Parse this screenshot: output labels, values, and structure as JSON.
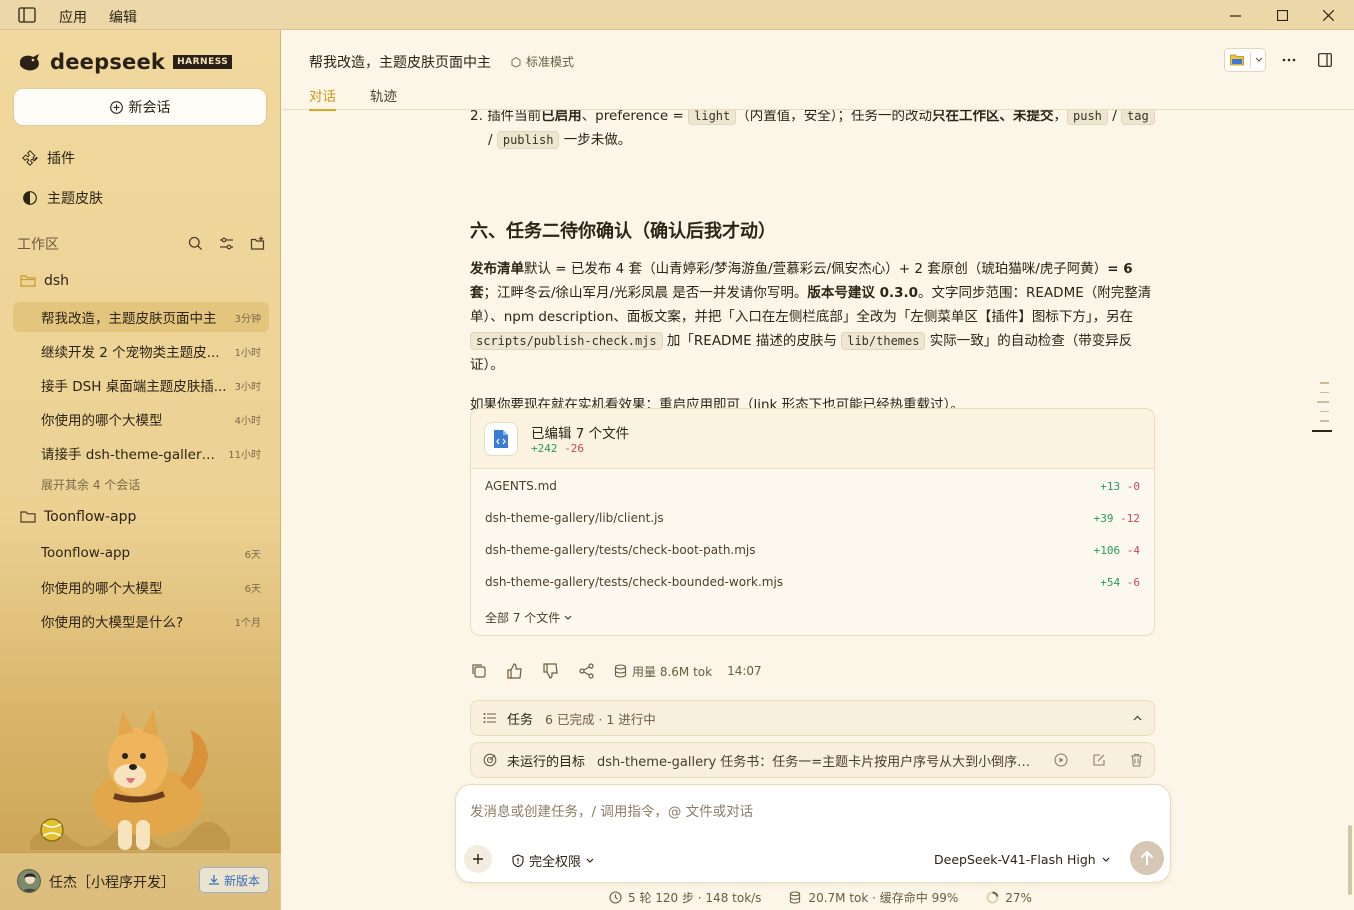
{
  "titlebar": {
    "menu": [
      "应用",
      "编辑"
    ]
  },
  "sidebar": {
    "brand": "deepseek",
    "brand_badge": "HARNESS",
    "new_chat": "新会话",
    "nav": [
      {
        "label": "插件",
        "icon": "puzzle-icon"
      },
      {
        "label": "主题皮肤",
        "icon": "theme-icon"
      }
    ],
    "workspace_label": "工作区",
    "folders": [
      {
        "name": "dsh",
        "sessions": [
          {
            "title": "帮我改造，主题皮肤页面中主",
            "time": "3分钟",
            "active": true
          },
          {
            "title": "继续开发 2 个宠物类主题皮...",
            "time": "1小时"
          },
          {
            "title": "接手 DSH 桌面端主题皮肤插...",
            "time": "3小时"
          },
          {
            "title": "你使用的哪个大模型",
            "time": "4小时"
          },
          {
            "title": "请接手 dsh-theme-gallery ...",
            "time": "11小时"
          }
        ],
        "more": "展开其余 4 个会话"
      },
      {
        "name": "Toonflow-app",
        "sessions": [
          {
            "title": "Toonflow-app",
            "time": "6天"
          },
          {
            "title": "你使用的哪个大模型",
            "time": "6天"
          },
          {
            "title": "你使用的大模型是什么?",
            "time": "1个月"
          }
        ]
      }
    ],
    "user": {
      "name": "任杰［小程序开发］",
      "new_version": "新版本"
    }
  },
  "header": {
    "title": "帮我改造，主题皮肤页面中主",
    "mode": "标准模式",
    "tabs": [
      {
        "label": "对话",
        "active": true
      },
      {
        "label": "轨迹",
        "active": false
      }
    ]
  },
  "message": {
    "list_item": {
      "num": "2.",
      "p1": "插件当前",
      "p2": "已启用",
      "p3": "、preference = ",
      "c1": "light",
      "p4": "（内置值，安全）；任务一的改动",
      "p5": "只在工作区、未提交",
      "p6": "，",
      "c2": "push",
      "p7": " / ",
      "c3": "tag",
      "p8": " / ",
      "c4": "publish",
      "p9": " 一步未做。"
    },
    "section_title": "六、任务二待你确认（确认后我才动）",
    "para1": {
      "b1": "发布清单",
      "t1": "默认 = 已发布 4 套（山青婷彩/梦海游鱼/萱慕彩云/佩安杰心）+ 2 套原创（琥珀猫咪/虎子阿黄）",
      "b2": "= 6 套",
      "t2": "；江畔冬云/徐山军月/光彩凤晨 是否一并发请你写明。",
      "b3": "版本号建议 0.3.0",
      "t3": "。文字同步范围：README（附完整清单）、npm description、面板文案，并把「入口在左侧栏底部」全改为「左侧菜单区【插件】图标下方」，另在 ",
      "c1": "scripts/publish-check.mjs",
      "t4": " 加「README 描述的皮肤与 ",
      "c2": "lib/themes",
      "t5": " 实际一致」的自动检查（带变异反证）。"
    },
    "para2": "如果你要现在就在实机看效果：重启应用即可（link 形态下也可能已经热重载过）。",
    "edits": {
      "title": "已编辑 7 个文件",
      "added": "+242",
      "removed": "-26",
      "files": [
        {
          "name": "AGENTS.md",
          "add": "+13",
          "del": "-0"
        },
        {
          "name": "dsh-theme-gallery/lib/client.js",
          "add": "+39",
          "del": "-12"
        },
        {
          "name": "dsh-theme-gallery/tests/check-boot-path.mjs",
          "add": "+106",
          "del": "-4"
        },
        {
          "name": "dsh-theme-gallery/tests/check-bounded-work.mjs",
          "add": "+54",
          "del": "-6"
        }
      ],
      "all_files": "全部 7 个文件"
    },
    "usage": "用量 8.6M tok",
    "time": "14:07"
  },
  "tasks": {
    "label": "任务",
    "status": "6 已完成 · 1 进行中"
  },
  "goal": {
    "label": "未运行的目标",
    "text": "dsh-theme-gallery 任务书：任务一=主题卡片按用户序号从大到小倒序展示..."
  },
  "composer": {
    "placeholder": "发消息或创建任务，/ 调用指令，@ 文件或对话",
    "permission": "完全权限",
    "model": "DeepSeek-V41-Flash High"
  },
  "status": {
    "steps": "5 轮 120 步 · 148 tok/s",
    "tokens": "20.7M tok · 缓存命中 99%",
    "context": "27%"
  },
  "colors": {
    "accent": "#e0a821",
    "added": "#2a9b5a",
    "removed": "#c9485b",
    "sidebar": "#f0d89e",
    "background": "#fcf6e8"
  }
}
